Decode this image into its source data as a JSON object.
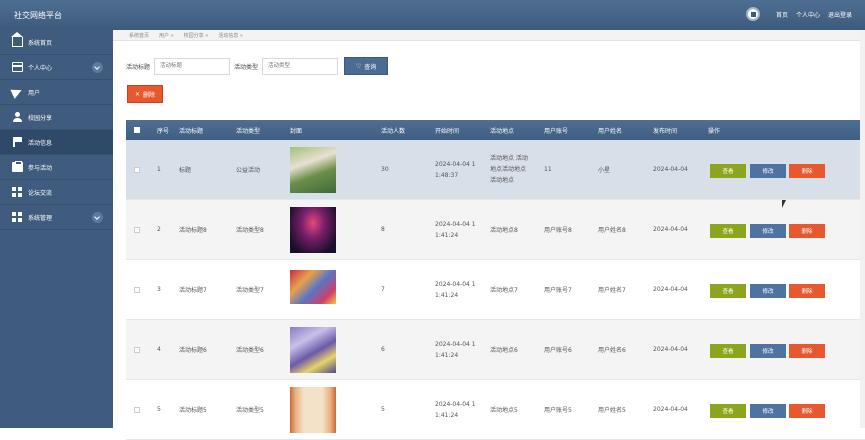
{
  "app": {
    "title": "社交网络平台",
    "nav": [
      "首页",
      "个人中心",
      "退出登录"
    ]
  },
  "sidebar": {
    "items": [
      {
        "label": "系统首页",
        "icon": "home-icon"
      },
      {
        "label": "个人中心",
        "icon": "id-card-icon",
        "expand": true
      },
      {
        "label": "用户",
        "icon": "paper-plane-icon"
      },
      {
        "label": "校园分享",
        "icon": "user-icon"
      },
      {
        "label": "活动信息",
        "icon": "flag-icon",
        "active": true
      },
      {
        "label": "参与活动",
        "icon": "clipboard-icon"
      },
      {
        "label": "论坛交流",
        "icon": "grid-icon"
      },
      {
        "label": "系统管理",
        "icon": "grid-icon",
        "expand": true
      }
    ]
  },
  "breadcrumb": [
    "系统首页",
    "用户 »",
    "校园分享 »",
    "活动信息 »"
  ],
  "search": {
    "title_label": "活动标题",
    "title_placeholder": "活动标题",
    "type_label": "活动类型",
    "type_placeholder": "活动类型",
    "button": "查询"
  },
  "toolbar": {
    "delete": "删除"
  },
  "table": {
    "headers": [
      "序号",
      "活动标题",
      "活动类型",
      "封面",
      "活动人数",
      "开始时间",
      "活动地点",
      "用户账号",
      "用户姓名",
      "发布时间",
      "操作"
    ],
    "actions": {
      "view": "查看",
      "edit": "修改",
      "delete": "删除"
    },
    "rows": [
      {
        "no": "1",
        "title": "标题",
        "type": "公益活动",
        "cover": "outdoor-group-photo",
        "people": "30",
        "start": "2024-04-04 1\n1:48:37",
        "place": "活动地点 活动\n地点活动地点\n活动地点",
        "account": "11",
        "name": "小星",
        "pub": "2024-04-04"
      },
      {
        "no": "2",
        "title": "活动标题8",
        "type": "活动类型8",
        "cover": "stage-lights-photo",
        "people": "8",
        "start": "2024-04-04 1\n1:41:24",
        "place": "活动地点8",
        "account": "用户账号8",
        "name": "用户姓名8",
        "pub": "2024-04-04"
      },
      {
        "no": "3",
        "title": "活动标题7",
        "type": "活动类型7",
        "cover": "festival-crowd-photo",
        "people": "7",
        "start": "2024-04-04 1\n1:41:24",
        "place": "活动地点7",
        "account": "用户账号7",
        "name": "用户姓名7",
        "pub": "2024-04-04"
      },
      {
        "no": "4",
        "title": "活动标题6",
        "type": "活动类型6",
        "cover": "party-balloons-photo",
        "people": "6",
        "start": "2024-04-04 1\n1:41:24",
        "place": "活动地点6",
        "account": "用户账号6",
        "name": "用户姓名6",
        "pub": "2024-04-04"
      },
      {
        "no": "5",
        "title": "活动标题5",
        "type": "活动类型5",
        "cover": "theater-curtain-photo",
        "people": "5",
        "start": "2024-04-04 1\n1:41:24",
        "place": "活动地点5",
        "account": "用户账号5",
        "name": "用户姓名5",
        "pub": "2024-04-04"
      }
    ]
  }
}
